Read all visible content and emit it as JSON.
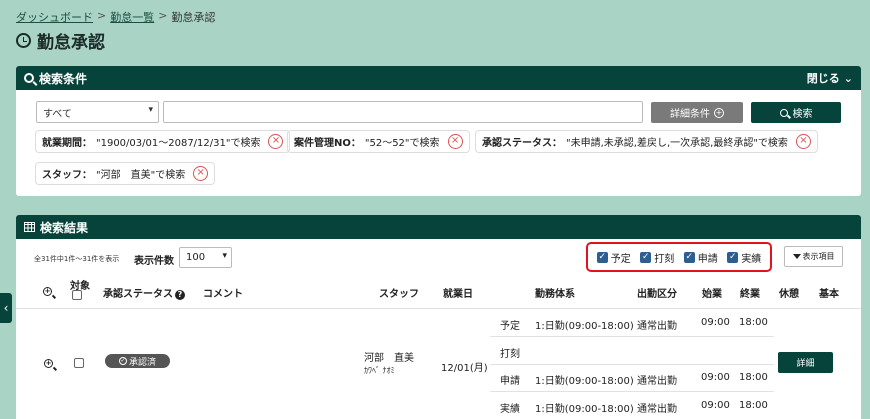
{
  "breadcrumb": {
    "dashboard": "ダッシュボード",
    "list": "勤怠一覧",
    "current": "勤怠承認",
    "sep": ">"
  },
  "page": {
    "title": "勤怠承認"
  },
  "search": {
    "title": "検索条件",
    "close_label": "閉じる",
    "close_icon": "chevron-down-icon",
    "select_value": "すべて",
    "text_value": "",
    "detail_button": "詳細条件",
    "search_button": "検索"
  },
  "chips": [
    {
      "label": "就業期間：",
      "value": "\"1900/03/01～2087/12/31\"で検索"
    },
    {
      "label": "案件管理NO：",
      "value": "\"52～52\"で検索"
    },
    {
      "label": "承認ステータス：",
      "value": "\"未申請,未承認,差戻し,一次承認,最終承認\"で検索"
    },
    {
      "label": "スタッフ：",
      "value": "\"河部　直美\"で検索"
    }
  ],
  "results": {
    "title": "検索結果",
    "count_text": "全31件中1件～31件を表示",
    "perpage_label": "表示件数",
    "perpage_value": "100",
    "filters": [
      "予定",
      "打刻",
      "申請",
      "実績"
    ],
    "columns_button": "表示項目",
    "headers": {
      "target": "対象",
      "status": "承認ステータス",
      "comment": "コメント",
      "staff": "スタッフ",
      "date": "就業日",
      "system": "勤務体系",
      "category": "出勤区分",
      "start": "始業",
      "end": "終業",
      "rest": "休憩",
      "basic": "基本"
    },
    "row": {
      "status": "承認済",
      "staff_name": "河部　直美",
      "staff_kana": "ｶﾜﾍﾞ ﾅｵﾐ",
      "date": "12/01(月)",
      "detail_button": "詳細",
      "lines": [
        {
          "type": "予定",
          "system": "1:日勤(09:00-18:00)",
          "category": "通常出勤",
          "start": "09:00",
          "end": "18:00"
        },
        {
          "type": "打刻",
          "system": "",
          "category": "",
          "start": "",
          "end": ""
        },
        {
          "type": "申請",
          "system": "1:日勤(09:00-18:00)",
          "category": "通常出勤",
          "start": "09:00",
          "end": "18:00"
        },
        {
          "type": "実績",
          "system": "1:日勤(09:00-18:00)",
          "category": "通常出勤",
          "start": "09:00",
          "end": "18:00"
        }
      ]
    }
  },
  "colors": {
    "brand": "#06433a",
    "background": "#a9d3c4",
    "highlight": "#e0141e",
    "checkbox": "#2b5f8f"
  }
}
